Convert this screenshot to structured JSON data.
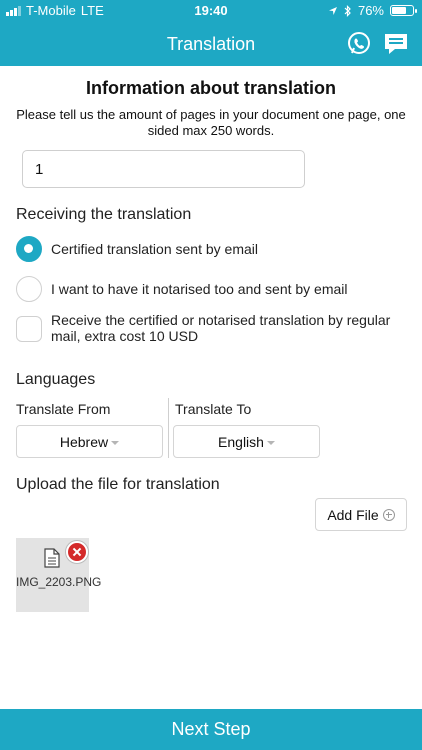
{
  "status_bar": {
    "carrier": "T-Mobile",
    "network": "LTE",
    "time": "19:40",
    "battery_percent": "76%",
    "battery_level": 0.76
  },
  "navbar": {
    "title": "Translation"
  },
  "info": {
    "title": "Information about translation",
    "description": "Please tell us the amount of pages in your document one page, one sided max 250 words.",
    "pages_value": "1"
  },
  "receiving": {
    "title": "Receiving the translation",
    "options": [
      {
        "label": "Certified translation sent by email",
        "selected": true
      },
      {
        "label": "I want to have it notarised too and sent by email",
        "selected": false
      },
      {
        "label": "Receive the certified or notarised translation by regular mail, extra cost 10 USD",
        "selected": false
      }
    ]
  },
  "languages": {
    "title": "Languages",
    "from_label": "Translate From",
    "to_label": "Translate To",
    "from_value": "Hebrew",
    "to_value": "English"
  },
  "upload": {
    "title": "Upload the file for translation",
    "add_file_label": "Add File",
    "files": [
      {
        "name": "IMG_2203.PNG"
      }
    ]
  },
  "footer": {
    "next_label": "Next Step"
  },
  "colors": {
    "accent": "#1ea8c4",
    "remove": "#d42a2a"
  },
  "icons": {
    "chat": "phone-chat-icon",
    "message": "message-icon",
    "file": "document-icon",
    "remove": "remove-icon",
    "add": "plus-circle-icon"
  }
}
